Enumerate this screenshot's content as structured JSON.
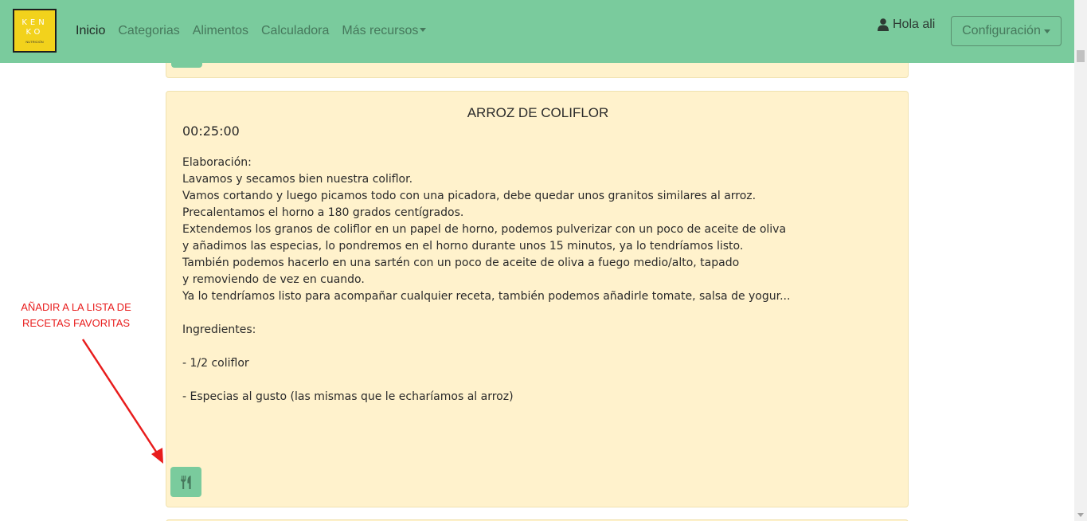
{
  "navbar": {
    "logo": {
      "line1": "KEN",
      "line2": "KO",
      "tagline": "NUTRICIÓN"
    },
    "links": [
      {
        "label": "Inicio",
        "active": true
      },
      {
        "label": "Categorias"
      },
      {
        "label": "Alimentos"
      },
      {
        "label": "Calculadora"
      },
      {
        "label": "Más recursos",
        "dropdown": true
      }
    ],
    "greeting": "Hola ali",
    "config_label": "Configuración"
  },
  "recipe": {
    "title": "ARROZ DE COLIFLOR",
    "time": "00:25:00",
    "lines": [
      "Elaboración:",
      "Lavamos y secamos bien nuestra coliflor.",
      "Vamos cortando y luego picamos todo con una picadora, debe quedar unos granitos similares al arroz.",
      "Precalentamos el horno a 180 grados centígrados.",
      "Extendemos los granos de coliflor en un papel de horno, podemos pulverizar con un poco de aceite de oliva",
      "y añadimos las especias, lo pondremos en el horno durante unos 15 minutos, ya lo tendríamos listo.",
      "También podemos hacerlo en una sartén con un poco de aceite de oliva a fuego medio/alto, tapado",
      "y removiendo de vez en cuando.",
      "Ya lo tendríamos listo para acompañar cualquier receta, también podemos añadirle tomate, salsa de yogur...",
      "",
      "Ingredientes:",
      "",
      "- 1/2 coliflor",
      "",
      "- Especias al gusto (las mismas que le echaríamos al arroz)"
    ]
  },
  "annotation": {
    "line1": "AÑADIR A LA LISTA DE",
    "line2": "RECETAS FAVORITAS"
  },
  "colors": {
    "navbar": "#7acb9d",
    "card": "#fff2cc",
    "annotation": "#e81c1c"
  },
  "icons": {
    "user": "user-icon",
    "favorite": "utensils-icon"
  }
}
